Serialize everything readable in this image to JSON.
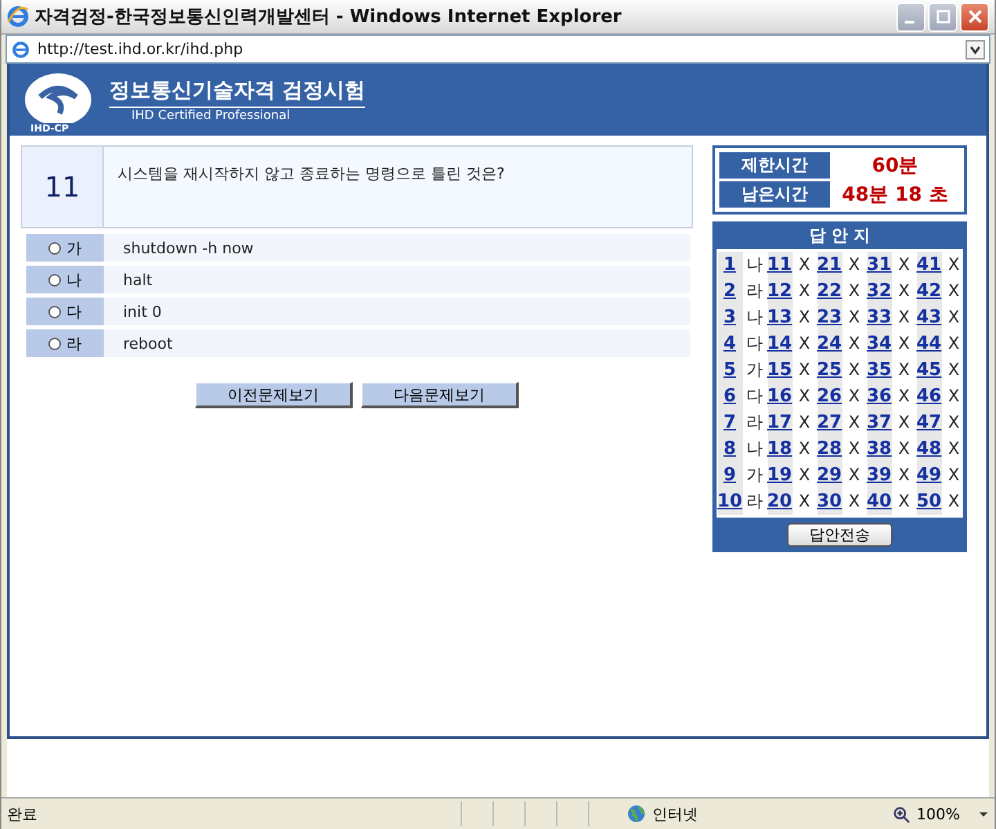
{
  "window": {
    "title": "자격검정-한국정보통신인력개발센터 - Windows Internet Explorer"
  },
  "address_bar": {
    "url": "http://test.ihd.or.kr/ihd.php"
  },
  "header": {
    "logo_text": "IHD-CP",
    "title": "정보통신기술자격 검정시험",
    "subtitle": "IHD Certified Professional"
  },
  "question": {
    "number": "11",
    "text": "시스템을 재시작하지 않고 종료하는 명령으로 틀린 것은?"
  },
  "options": [
    {
      "label": "가",
      "text": "shutdown -h now",
      "selected": false
    },
    {
      "label": "나",
      "text": "halt",
      "selected": false
    },
    {
      "label": "다",
      "text": "init 0",
      "selected": false
    },
    {
      "label": "라",
      "text": "reboot",
      "selected": false
    }
  ],
  "buttons": [
    "이전문제보기",
    "다음문제보기"
  ],
  "timer": [
    {
      "label": "제한시간",
      "value": "60분"
    },
    {
      "label": "남은시간",
      "value": "48분 18 초"
    }
  ],
  "answer_sheet": {
    "title": "답 안 지",
    "rows": [
      [
        {
          "number": "1",
          "answer": "나"
        },
        {
          "number": "11",
          "answer": "X"
        },
        {
          "number": "21",
          "answer": "X"
        },
        {
          "number": "31",
          "answer": "X"
        },
        {
          "number": "41",
          "answer": "X"
        }
      ],
      [
        {
          "number": "2",
          "answer": "라"
        },
        {
          "number": "12",
          "answer": "X"
        },
        {
          "number": "22",
          "answer": "X"
        },
        {
          "number": "32",
          "answer": "X"
        },
        {
          "number": "42",
          "answer": "X"
        }
      ],
      [
        {
          "number": "3",
          "answer": "나"
        },
        {
          "number": "13",
          "answer": "X"
        },
        {
          "number": "23",
          "answer": "X"
        },
        {
          "number": "33",
          "answer": "X"
        },
        {
          "number": "43",
          "answer": "X"
        }
      ],
      [
        {
          "number": "4",
          "answer": "다"
        },
        {
          "number": "14",
          "answer": "X"
        },
        {
          "number": "24",
          "answer": "X"
        },
        {
          "number": "34",
          "answer": "X"
        },
        {
          "number": "44",
          "answer": "X"
        }
      ],
      [
        {
          "number": "5",
          "answer": "가"
        },
        {
          "number": "15",
          "answer": "X"
        },
        {
          "number": "25",
          "answer": "X"
        },
        {
          "number": "35",
          "answer": "X"
        },
        {
          "number": "45",
          "answer": "X"
        }
      ],
      [
        {
          "number": "6",
          "answer": "다"
        },
        {
          "number": "16",
          "answer": "X"
        },
        {
          "number": "26",
          "answer": "X"
        },
        {
          "number": "36",
          "answer": "X"
        },
        {
          "number": "46",
          "answer": "X"
        }
      ],
      [
        {
          "number": "7",
          "answer": "라"
        },
        {
          "number": "17",
          "answer": "X"
        },
        {
          "number": "27",
          "answer": "X"
        },
        {
          "number": "37",
          "answer": "X"
        },
        {
          "number": "47",
          "answer": "X"
        }
      ],
      [
        {
          "number": "8",
          "answer": "나"
        },
        {
          "number": "18",
          "answer": "X"
        },
        {
          "number": "28",
          "answer": "X"
        },
        {
          "number": "38",
          "answer": "X"
        },
        {
          "number": "48",
          "answer": "X"
        }
      ],
      [
        {
          "number": "9",
          "answer": "가"
        },
        {
          "number": "19",
          "answer": "X"
        },
        {
          "number": "29",
          "answer": "X"
        },
        {
          "number": "39",
          "answer": "X"
        },
        {
          "number": "49",
          "answer": "X"
        }
      ],
      [
        {
          "number": "10",
          "answer": "라"
        },
        {
          "number": "20",
          "answer": "X"
        },
        {
          "number": "30",
          "answer": "X"
        },
        {
          "number": "40",
          "answer": "X"
        },
        {
          "number": "50",
          "answer": "X"
        }
      ]
    ],
    "submit": "답안전송"
  },
  "status_bar": {
    "status": "완료",
    "zone": "인터넷",
    "zoom": "100%"
  }
}
